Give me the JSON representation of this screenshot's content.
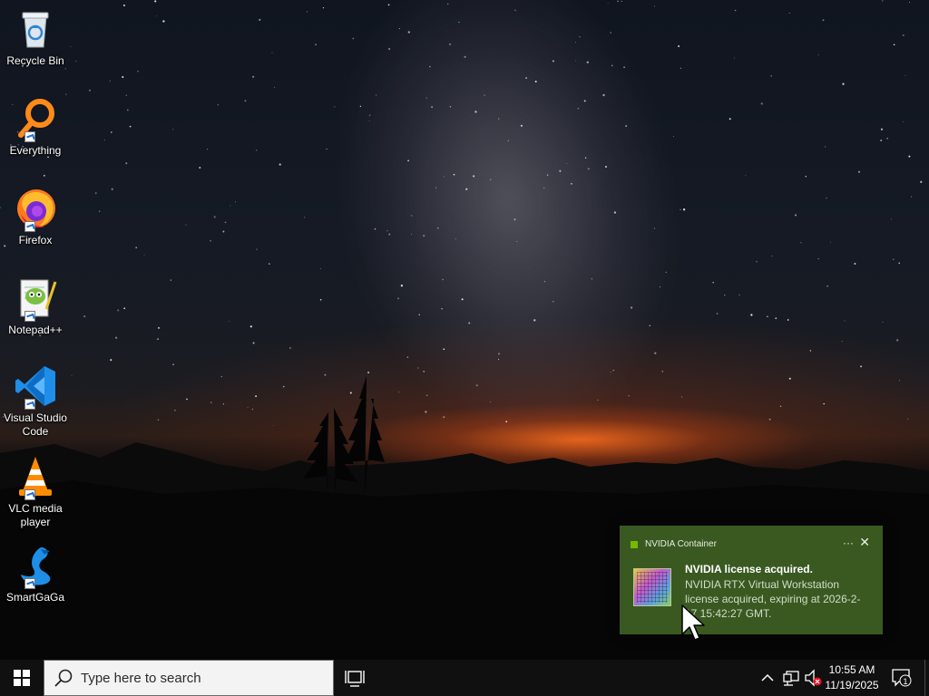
{
  "desktop": {
    "icons": [
      {
        "label": "Recycle Bin",
        "icon": "recycle-bin-icon",
        "shortcut": false
      },
      {
        "label": "Everything",
        "icon": "everything-search-icon",
        "shortcut": true
      },
      {
        "label": "Firefox",
        "icon": "firefox-icon",
        "shortcut": true
      },
      {
        "label": "Notepad++",
        "icon": "notepad-plus-plus-icon",
        "shortcut": true
      },
      {
        "label": "Visual Studio Code",
        "icon": "vscode-icon",
        "shortcut": true
      },
      {
        "label": "VLC media player",
        "icon": "vlc-icon",
        "shortcut": true
      },
      {
        "label": "SmartGaGa",
        "icon": "smartgaga-icon",
        "shortcut": true
      }
    ]
  },
  "notification": {
    "app_name": "NVIDIA Container",
    "more_label": "···",
    "close_label": "✕",
    "title": "NVIDIA license acquired.",
    "body": "NVIDIA RTX Virtual Workstation license acquired, expiring at 2026-2-17 15:42:27 GMT.",
    "accent_color": "#76b900"
  },
  "taskbar": {
    "search_placeholder": "Type here to search",
    "clock_time": "10:55 AM",
    "clock_date": "11/19/2025",
    "notification_count": "1"
  }
}
